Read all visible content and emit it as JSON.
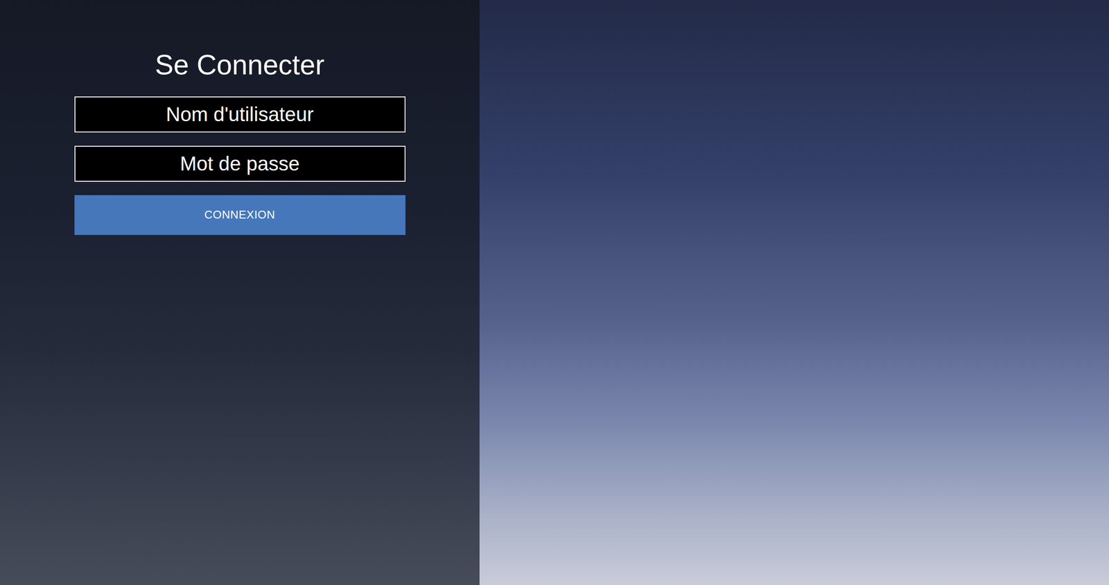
{
  "login": {
    "title": "Se Connecter",
    "fields": [
      {
        "placeholder": "Nom d'utilisateur",
        "kind": "text"
      },
      {
        "placeholder": "Mot de passe",
        "kind": "password"
      }
    ],
    "button": "CONNEXION"
  }
}
